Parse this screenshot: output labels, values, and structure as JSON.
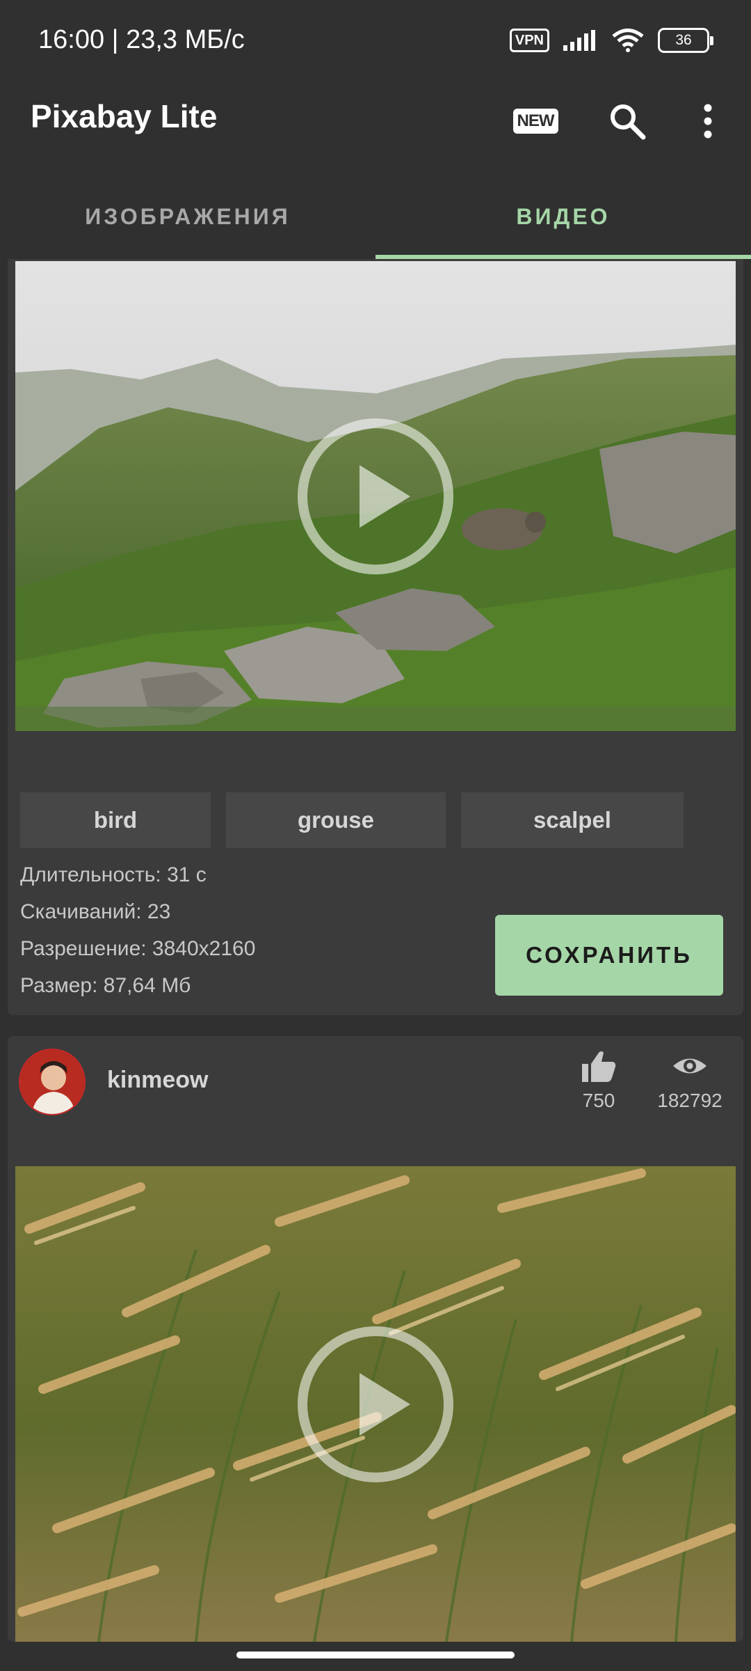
{
  "status_bar": {
    "time_speed": "16:00 | 23,3 МБ/с",
    "vpn": "VPN",
    "battery": "36",
    "icons": [
      "vpn-icon",
      "signal-icon",
      "wifi-icon",
      "battery-icon"
    ]
  },
  "app_bar": {
    "title": "Pixabay Lite",
    "new_badge": "NEW",
    "icons": [
      "new-icon",
      "search-icon",
      "more-vert-icon"
    ]
  },
  "tabs": [
    {
      "label": "ИЗОБРАЖЕНИЯ",
      "active": false
    },
    {
      "label": "ВИДЕО",
      "active": true
    }
  ],
  "videos": [
    {
      "tags": [
        "bird",
        "grouse",
        "scalpel"
      ],
      "duration": "Длительность: 31 с",
      "downloads": "Скачиваний: 23",
      "resolution": "Разрешение: 3840x2160",
      "size": "Размер: 87,64 Мб",
      "save_label": "СОХРАНИТЬ"
    },
    {
      "user": "kinmeow",
      "likes": "750",
      "views": "182792"
    }
  ],
  "colors": {
    "background": "#303030",
    "card": "#3b3b3b",
    "accent": "#a5d6a7"
  }
}
